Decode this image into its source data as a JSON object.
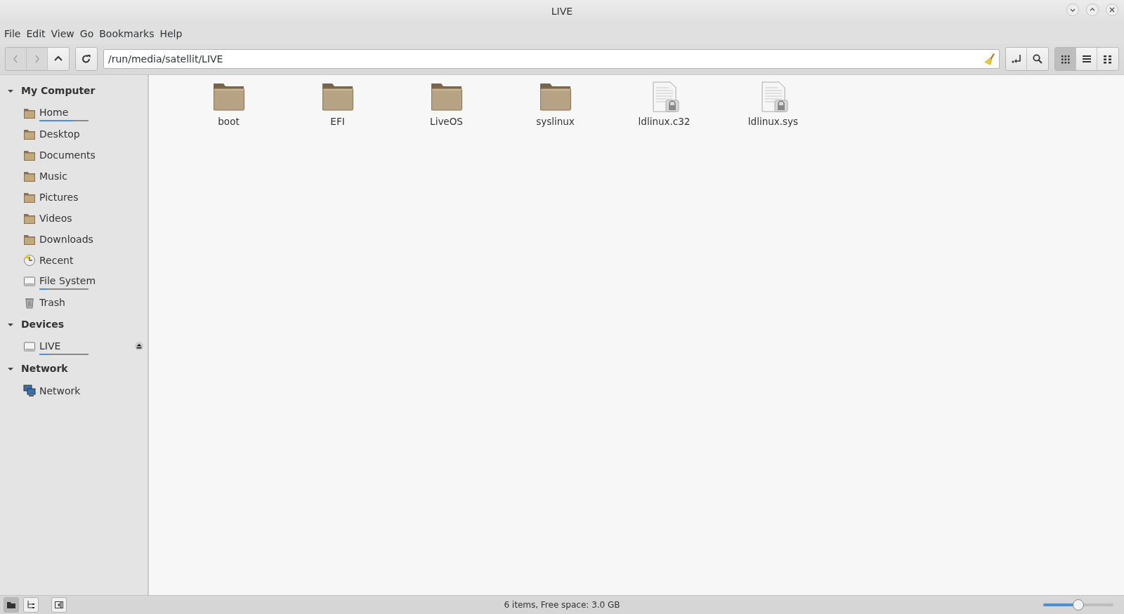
{
  "window": {
    "title": "LIVE"
  },
  "menu": [
    "File",
    "Edit",
    "View",
    "Go",
    "Bookmarks",
    "Help"
  ],
  "toolbar": {
    "nav": [
      {
        "kind": "back",
        "disabled": true
      },
      {
        "kind": "forward",
        "disabled": true
      },
      {
        "kind": "up",
        "disabled": false
      }
    ],
    "path": "/run/media/satellit/LIVE",
    "views": [
      {
        "kind": "icons",
        "selected": true
      },
      {
        "kind": "list",
        "selected": false
      },
      {
        "kind": "compact",
        "selected": false
      }
    ]
  },
  "sidebar": [
    {
      "title": "My Computer",
      "expanded": true,
      "items": [
        {
          "label": "Home",
          "kind": "folder",
          "level": 0.68
        },
        {
          "label": "Desktop",
          "kind": "folder"
        },
        {
          "label": "Documents",
          "kind": "folder"
        },
        {
          "label": "Music",
          "kind": "folder"
        },
        {
          "label": "Pictures",
          "kind": "folder"
        },
        {
          "label": "Videos",
          "kind": "folder"
        },
        {
          "label": "Downloads",
          "kind": "folder"
        },
        {
          "label": "Recent",
          "kind": "recent"
        },
        {
          "label": "File System",
          "kind": "drive",
          "level": 0.16
        },
        {
          "label": "Trash",
          "kind": "trash"
        }
      ]
    },
    {
      "title": "Devices",
      "expanded": true,
      "items": [
        {
          "label": "LIVE",
          "kind": "drive",
          "level": 0.2,
          "ejectable": true
        }
      ]
    },
    {
      "title": "Network",
      "expanded": true,
      "items": [
        {
          "label": "Network",
          "kind": "network"
        }
      ]
    }
  ],
  "files": [
    {
      "name": "boot",
      "kind": "folder"
    },
    {
      "name": "EFI",
      "kind": "folder"
    },
    {
      "name": "LiveOS",
      "kind": "folder"
    },
    {
      "name": "syslinux",
      "kind": "folder"
    },
    {
      "name": "ldlinux.c32",
      "kind": "locked-file"
    },
    {
      "name": "ldlinux.sys",
      "kind": "locked-file"
    }
  ],
  "status_bar": {
    "panes": [
      {
        "kind": "places",
        "selected": true
      },
      {
        "kind": "tree",
        "selected": false
      }
    ],
    "text": "6 items, Free space: 3.0 GB",
    "zoom": {
      "level": 0.5
    }
  }
}
